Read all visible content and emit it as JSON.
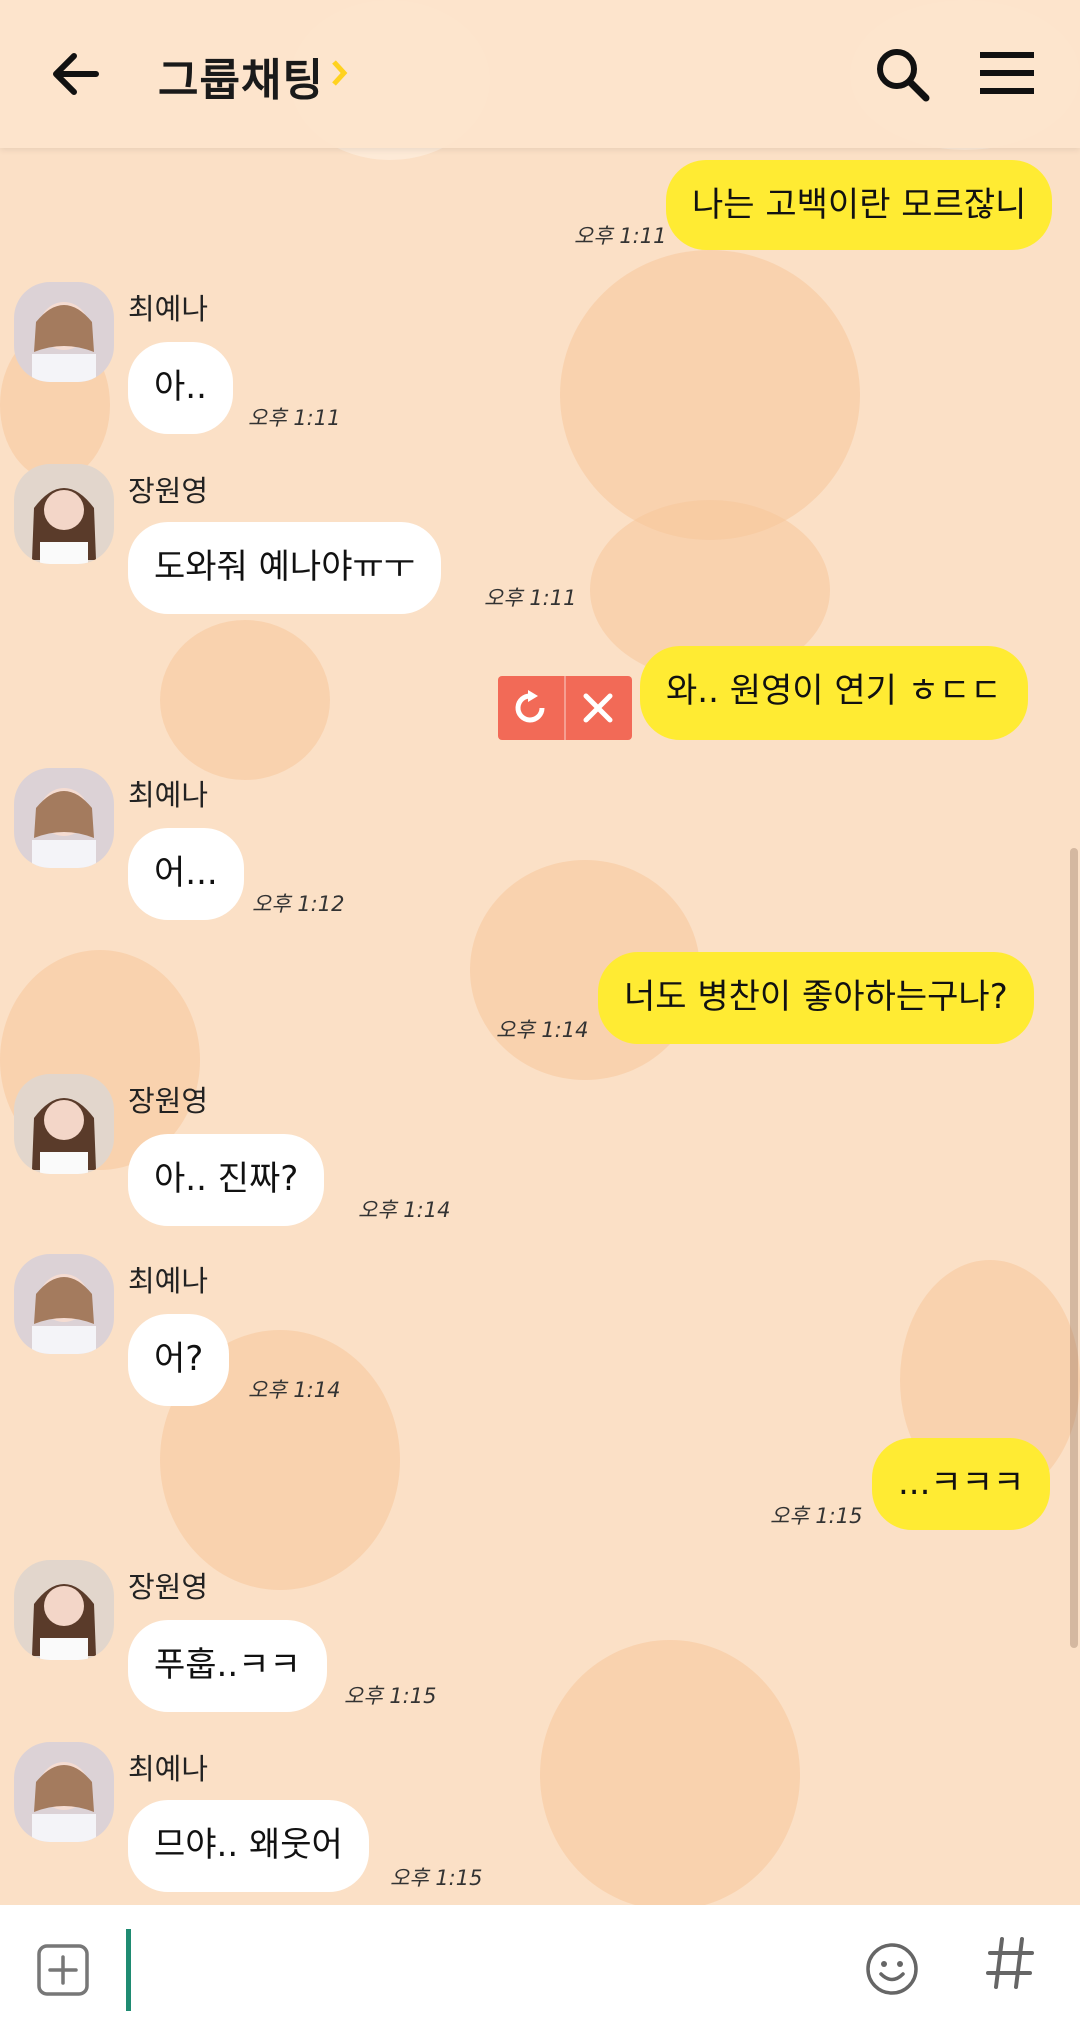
{
  "header": {
    "title": "그룹채팅"
  },
  "messages": [
    {
      "side": "me",
      "text": "나는 고백이란 모르잖니",
      "time": "오후 1:11"
    },
    {
      "side": "other",
      "sender": "최예나",
      "text": "아..",
      "time": "오후 1:11"
    },
    {
      "side": "other",
      "sender": "장원영",
      "text": "도와줘 예나야ㅠㅜ",
      "time": "오후 1:11"
    },
    {
      "side": "me",
      "text": "와.. 원영이 연기 ㅎㄷㄷ",
      "status": "failed"
    },
    {
      "side": "other",
      "sender": "최예나",
      "text": "어...",
      "time": "오후 1:12"
    },
    {
      "side": "me",
      "text": "너도 병찬이 좋아하는구나?",
      "time": "오후 1:14"
    },
    {
      "side": "other",
      "sender": "장원영",
      "text": "아.. 진짜?",
      "time": "오후 1:14"
    },
    {
      "side": "other",
      "sender": "최예나",
      "text": "어?",
      "time": "오후 1:14"
    },
    {
      "side": "me",
      "text": "...ㅋㅋㅋ",
      "time": "오후 1:15"
    },
    {
      "side": "other",
      "sender": "장원영",
      "text": "푸훕..ㅋㅋ",
      "time": "오후 1:15"
    },
    {
      "side": "other",
      "sender": "최예나",
      "text": "므야.. 왜웃어",
      "time": "오후 1:15"
    }
  ],
  "input": {
    "value": ""
  },
  "colors": {
    "my_bubble": "#ffeb33",
    "other_bubble": "#ffffff",
    "failed": "#f26a57",
    "background": "#fbe0c6"
  },
  "icons": {
    "back": "arrow-left-icon",
    "search": "search-icon",
    "menu": "hamburger-menu-icon",
    "retry": "retry-icon",
    "cancel": "close-icon",
    "attach": "plus-square-icon",
    "emoji": "smiley-icon",
    "hash": "hash-icon"
  }
}
